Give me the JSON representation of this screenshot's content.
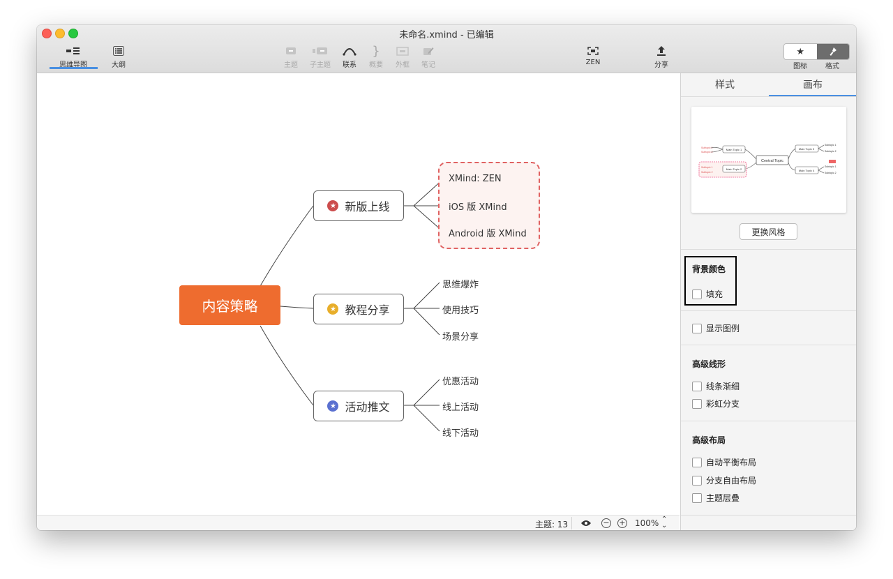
{
  "window": {
    "title": "未命名.xmind - 已编辑"
  },
  "toolbar": {
    "mindmap": "思维导图",
    "outline": "大纲",
    "topic": "主题",
    "subtopic": "子主题",
    "relationship": "联系",
    "summary": "概要",
    "boundary": "外框",
    "notes": "笔记",
    "zen": "ZEN",
    "share": "分享",
    "icons_label": "图标",
    "format_label": "格式"
  },
  "mindmap": {
    "central": "内容策略",
    "branches": [
      {
        "label": "新版上线",
        "star_color": "#cc4d4d",
        "children": [
          "XMind: ZEN",
          "iOS 版 XMind",
          "Android 版 XMind"
        ]
      },
      {
        "label": "教程分享",
        "star_color": "#e8ae2a",
        "children": [
          "思维爆炸",
          "使用技巧",
          "场景分享"
        ]
      },
      {
        "label": "活动推文",
        "star_color": "#5a70d0",
        "children": [
          "优惠活动",
          "线上活动",
          "线下活动"
        ]
      }
    ]
  },
  "statusbar": {
    "topics": "主题: 13",
    "zoom": "100%"
  },
  "panel": {
    "tab_style": "样式",
    "tab_canvas": "画布",
    "preview": {
      "central": "Central Topic",
      "main1": "Main Topic 1",
      "main2": "Main Topic 2",
      "main3": "Main Topic 3",
      "main4": "Main Topic 4",
      "sub1": "Subtopic 1",
      "sub2": "Subtopic 2"
    },
    "change_style": "更换风格",
    "bg_title": "背景颜色",
    "fill": "填充",
    "show_legend": "显示图例",
    "adv_line_title": "高级线形",
    "taper": "线条渐细",
    "rainbow": "彩虹分支",
    "adv_layout_title": "高级布局",
    "auto_balance": "自动平衡布局",
    "free_layout": "分支自由布局",
    "overlap": "主题层叠"
  }
}
